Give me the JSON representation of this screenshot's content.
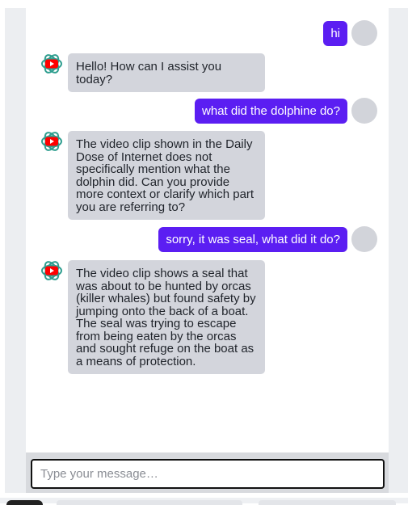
{
  "chat": {
    "messages": [
      {
        "role": "user",
        "text": "hi"
      },
      {
        "role": "bot",
        "text": "Hello! How can I assist you today?",
        "avatar_icon": "youtube-logo-icon"
      },
      {
        "role": "user",
        "text": "what did the dolphine do?"
      },
      {
        "role": "bot",
        "text": "The video clip shown in the Daily Dose of Internet does not specifically mention what the dolphin did. Can you provide more context or clarify which part you are referring to?",
        "avatar_icon": "youtube-logo-icon"
      },
      {
        "role": "user",
        "text": "sorry, it was seal, what did it do?"
      },
      {
        "role": "bot",
        "text": "The video clip shows a seal that was about to be hunted by orcas (killer whales) but found safety by jumping onto the back of a boat. The seal was trying to escape from being eaten by the orcas and sought refuge on the boat as a means of protection.",
        "avatar_icon": "youtube-logo-icon"
      }
    ]
  },
  "composer": {
    "placeholder": "Type your message…",
    "value": ""
  },
  "colors": {
    "user_bubble": "#5b1ef2",
    "bot_bubble": "#d3d5dc",
    "avatar_placeholder": "#d2d4da",
    "youtube_red": "#ff0000",
    "openai_knot": "#2f9e8f"
  }
}
